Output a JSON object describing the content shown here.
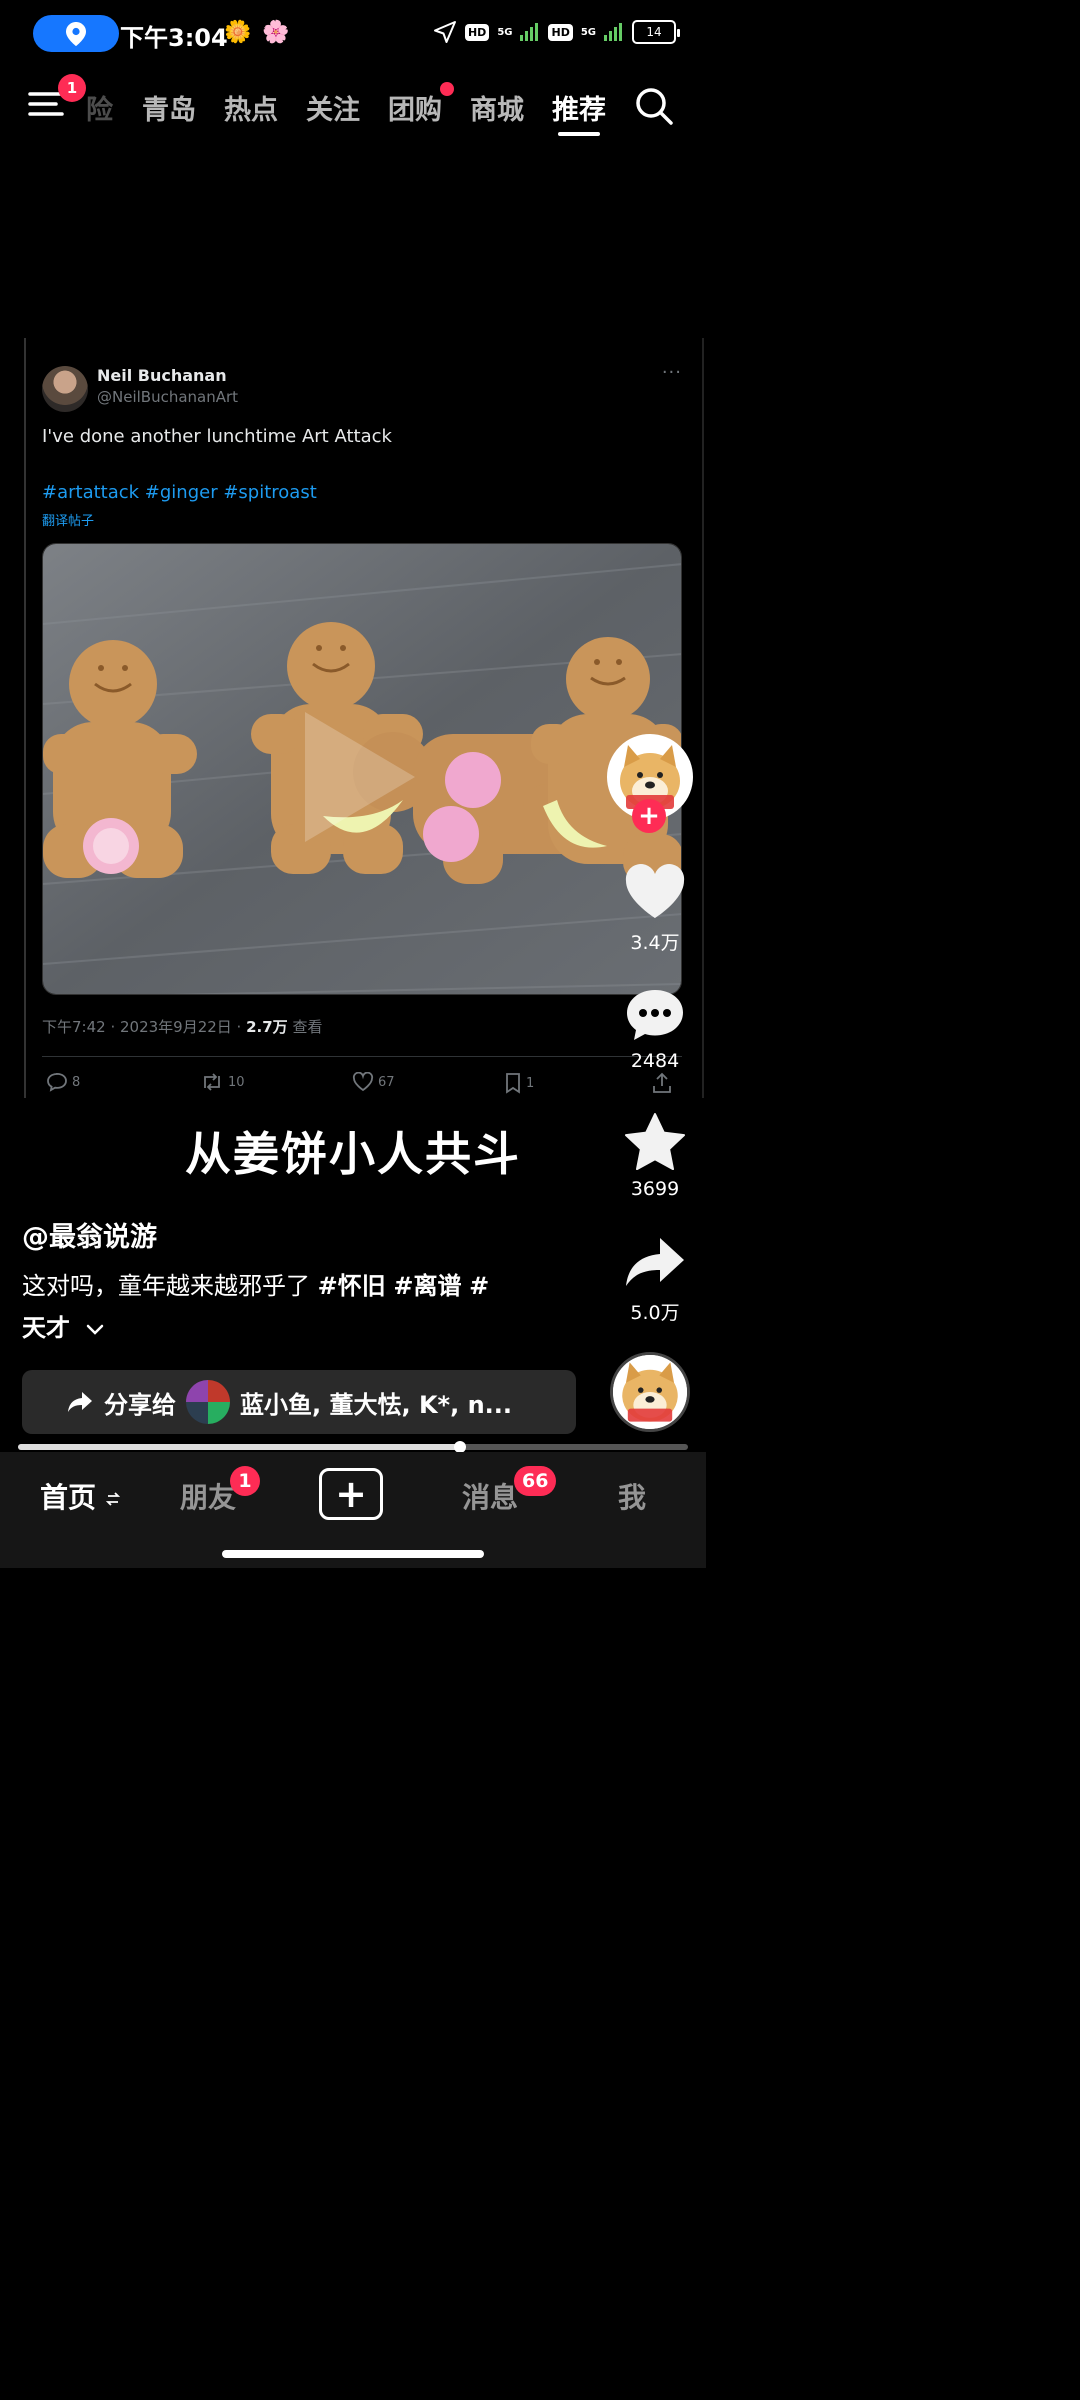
{
  "status_bar": {
    "time": "下午3:04",
    "emoji_1": "🌼",
    "emoji_2": "🌸",
    "hd_1": "HD",
    "net_1": "5G",
    "hd_2": "HD",
    "net_2": "5G",
    "battery": "14"
  },
  "top_nav": {
    "menu_badge": "1",
    "partial_tab": "险",
    "tabs": [
      "青岛",
      "热点",
      "关注",
      "团购",
      "商城",
      "推荐"
    ],
    "active_tab": "推荐"
  },
  "tweet": {
    "author_name": "Neil Buchanan",
    "author_handle": "@NeilBuchananArt",
    "more": "···",
    "text": "I've done another lunchtime Art Attack",
    "hashtags": "#artattack #ginger #spitroast",
    "translate": "翻译帖子",
    "time": "下午7:42 · 2023年9月22日 · ",
    "views": "2.7万",
    "views_label": " 查看",
    "replies": "8",
    "retweets": "10",
    "likes": "67",
    "bookmarks": "1"
  },
  "video": {
    "caption": "从姜饼小人共斗",
    "progress": 0.66
  },
  "rail": {
    "likes": "3.4万",
    "comments": "2484",
    "favorites": "3699",
    "shares": "5.0万",
    "follow_plus": "+"
  },
  "post": {
    "author": "@最翁说游",
    "desc_text": "这对吗，童年越来越邪乎了 ",
    "tag_1": "#怀旧",
    "tag_2": "#离谱",
    "tag_3": "#",
    "desc_line2": "天才",
    "share_label": "分享给",
    "share_names": "蓝小鱼, 董大怯, K*, n..."
  },
  "bottom_nav": {
    "home": "首页",
    "friends": "朋友",
    "friends_badge": "1",
    "add": "+",
    "messages": "消息",
    "messages_badge": "66",
    "me": "我"
  },
  "colors": {
    "accent_red": "#fe2c55",
    "twitter_blue": "#1d9bf0",
    "location_blue": "#1677ff"
  }
}
